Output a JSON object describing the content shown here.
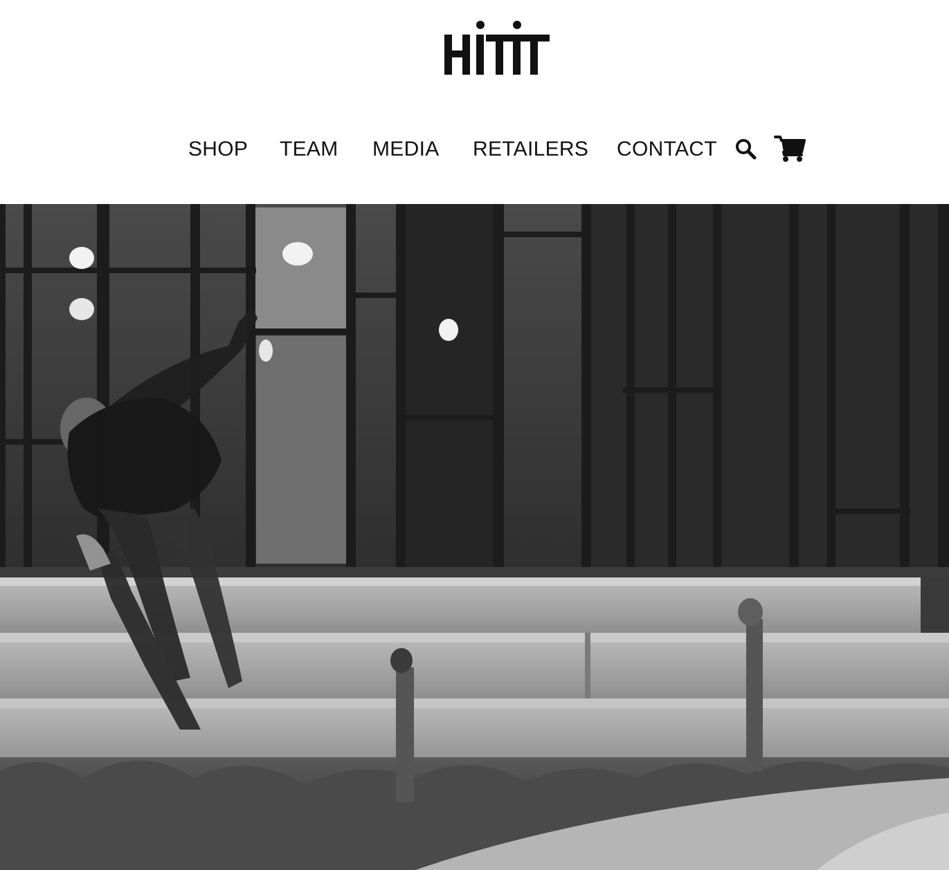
{
  "brand": {
    "logo_text": "HiTiT",
    "logo_icon": "brand-wordmark"
  },
  "nav": {
    "items": [
      {
        "label": "SHOP"
      },
      {
        "label": "TEAM"
      },
      {
        "label": "MEDIA"
      },
      {
        "label": "RETAILERS"
      },
      {
        "label": "CONTACT"
      }
    ],
    "search_icon": "search-icon",
    "cart_icon": "cart-icon"
  },
  "hero": {
    "style": "black-and-white photo",
    "subject": "skateboarder"
  },
  "colors": {
    "text": "#111111",
    "background": "#ffffff"
  }
}
